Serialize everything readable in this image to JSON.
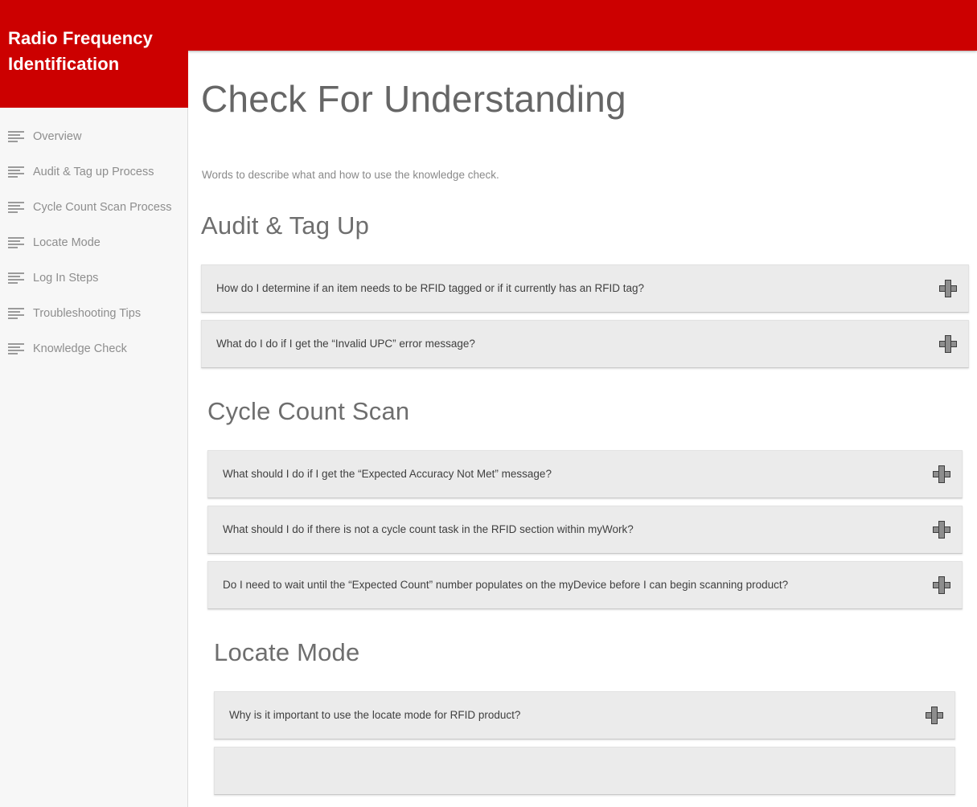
{
  "sidebar": {
    "brand_title": "Radio Frequency Identification",
    "nav_items": [
      {
        "label": "Overview",
        "icon": "list-lines-icon"
      },
      {
        "label": "Audit & Tag up Process",
        "icon": "list-lines-icon"
      },
      {
        "label": "Cycle Count Scan Process",
        "icon": "list-lines-icon"
      },
      {
        "label": "Locate Mode",
        "icon": "list-lines-icon"
      },
      {
        "label": "Log In Steps",
        "icon": "list-lines-icon"
      },
      {
        "label": "Troubleshooting Tips",
        "icon": "list-lines-icon"
      },
      {
        "label": "Knowledge Check",
        "icon": "list-lines-icon"
      }
    ]
  },
  "header": {
    "accent_color": "#cc0000"
  },
  "main": {
    "page_title": "Check For Understanding",
    "page_subtitle": "Words to describe what and how to use the knowledge check.",
    "sections": [
      {
        "heading": "Audit & Tag Up",
        "items": [
          {
            "question": "How do I determine if an item needs to be RFID tagged or if it currently has an RFID tag?",
            "toggle_icon": "plus-icon"
          },
          {
            "question": "What do I do if I get the “Invalid UPC” error message?",
            "toggle_icon": "plus-icon"
          }
        ]
      },
      {
        "heading": "Cycle Count Scan",
        "items": [
          {
            "question": "What should I do if I get the “Expected Accuracy Not Met” message?",
            "toggle_icon": "plus-icon"
          },
          {
            "question": "What should I do if there is not a cycle count task in the RFID section within myWork?",
            "toggle_icon": "plus-icon"
          },
          {
            "question": "Do I need to wait until the “Expected Count” number populates on the myDevice before I can begin scanning product?",
            "toggle_icon": "plus-icon"
          }
        ]
      },
      {
        "heading": "Locate Mode",
        "items": [
          {
            "question": "Why is it important to use the locate mode for RFID product?",
            "toggle_icon": "plus-icon"
          },
          {
            "question": "",
            "toggle_icon": "plus-icon"
          }
        ]
      }
    ]
  }
}
